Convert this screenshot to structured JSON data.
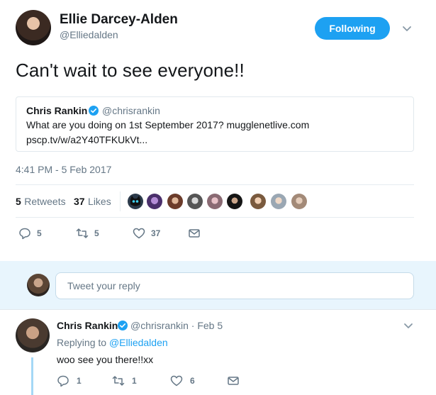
{
  "author": {
    "name": "Ellie Darcey-Alden",
    "handle": "@Elliedalden",
    "follow_label": "Following"
  },
  "tweet": {
    "text": "Can't wait to see everyone!!",
    "timestamp": "4:41 PM - 5 Feb 2017"
  },
  "quote": {
    "name": "Chris Rankin",
    "handle": "@chrisrankin",
    "line1": "What are you doing on 1st September 2017? mugglenetlive.com",
    "line2": "pscp.tv/w/a2Y40TFKUkVt..."
  },
  "stats": {
    "retweets_count": "5",
    "retweets_label": "Retweets",
    "likes_count": "37",
    "likes_label": "Likes"
  },
  "actions": {
    "reply_count": "5",
    "retweet_count": "5",
    "like_count": "37"
  },
  "reply_box": {
    "placeholder": "Tweet your reply"
  },
  "reply": {
    "name": "Chris Rankin",
    "handle_time": "@chrisrankin · Feb 5",
    "replying_prefix": "Replying to ",
    "replying_to": "@Elliedalden",
    "text": "woo see you there!!xx",
    "reply_count": "1",
    "retweet_count": "1",
    "like_count": "6"
  },
  "colors": {
    "accent": "#1da1f2",
    "muted": "#657786",
    "reply_bg": "#e8f5fd",
    "thread_line": "#a5d8f6"
  },
  "likers": [
    "cat-avatar",
    "purple-avatar",
    "woman-avatar",
    "bw-avatar",
    "woman-avatar",
    "dark-avatar",
    "woman-avatar",
    "woman-avatar",
    "woman-avatar"
  ]
}
